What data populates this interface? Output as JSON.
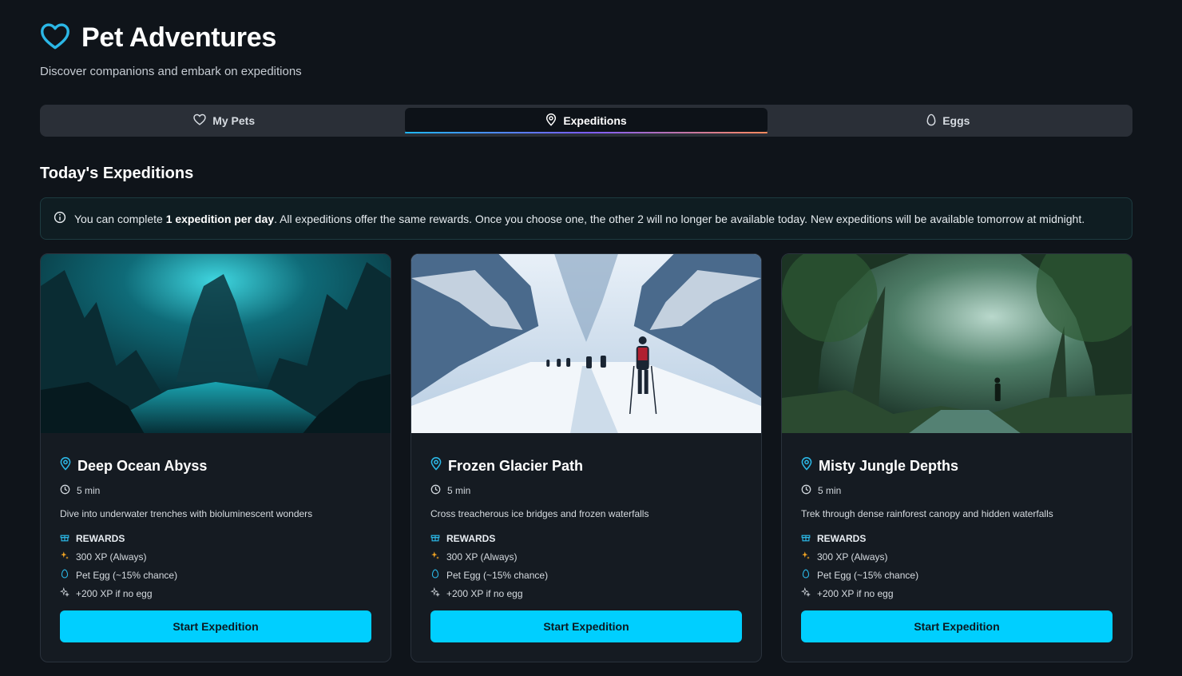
{
  "app": {
    "title": "Pet Adventures",
    "subtitle": "Discover companions and embark on expeditions",
    "icon": "heart-icon",
    "accent": "#2bb7e6"
  },
  "tabs": [
    {
      "label": "My Pets",
      "icon": "heart-icon",
      "active": false
    },
    {
      "label": "Expeditions",
      "icon": "map-pin-icon",
      "active": true
    },
    {
      "label": "Eggs",
      "icon": "egg-icon",
      "active": false
    }
  ],
  "section_title": "Today's Expeditions",
  "notice": {
    "icon": "info-icon",
    "prefix": "You can complete ",
    "bold": "1 expedition per day",
    "suffix": ". All expeditions offer the same rewards. Once you choose one, the other 2 will no longer be available today. New expeditions will be available tomorrow at midnight."
  },
  "expeditions": [
    {
      "name": "Deep Ocean Abyss",
      "duration": "5 min",
      "description": "Dive into underwater trenches with bioluminescent wonders",
      "rewards_label": "REWARDS",
      "rewards": [
        "300 XP (Always)",
        "Pet Egg (~15% chance)",
        "+200 XP if no egg"
      ],
      "button": "Start Expedition"
    },
    {
      "name": "Frozen Glacier Path",
      "duration": "5 min",
      "description": "Cross treacherous ice bridges and frozen waterfalls",
      "rewards_label": "REWARDS",
      "rewards": [
        "300 XP (Always)",
        "Pet Egg (~15% chance)",
        "+200 XP if no egg"
      ],
      "button": "Start Expedition"
    },
    {
      "name": "Misty Jungle Depths",
      "duration": "5 min",
      "description": "Trek through dense rainforest canopy and hidden waterfalls",
      "rewards_label": "REWARDS",
      "rewards": [
        "300 XP (Always)",
        "Pet Egg (~15% chance)",
        "+200 XP if no egg"
      ],
      "button": "Start Expedition"
    }
  ],
  "colors": {
    "background": "#0f141a",
    "card": "#151b22",
    "button": "#00cfff",
    "xp_star": "#f5a623",
    "egg": "#2bb7e6"
  }
}
